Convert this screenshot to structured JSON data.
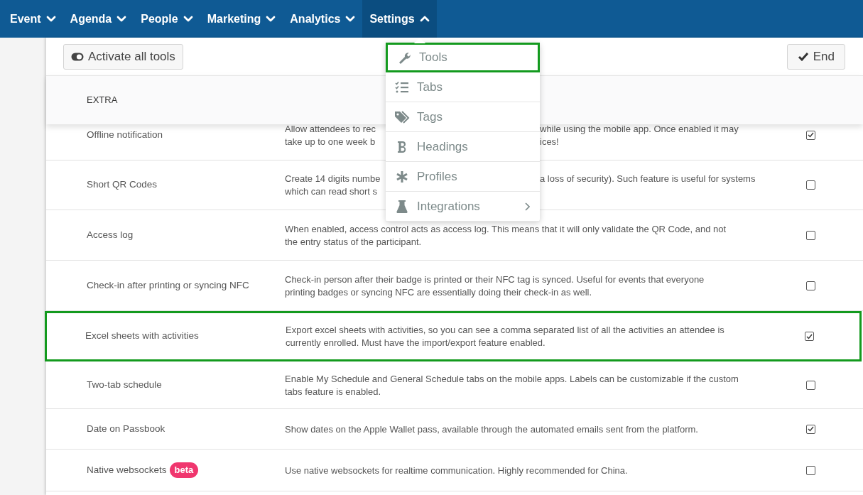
{
  "nav": [
    {
      "label": "Event",
      "expanded": false,
      "selected": false
    },
    {
      "label": "Agenda",
      "expanded": false,
      "selected": false
    },
    {
      "label": "People",
      "expanded": false,
      "selected": false
    },
    {
      "label": "Marketing",
      "expanded": false,
      "selected": false
    },
    {
      "label": "Analytics",
      "expanded": false,
      "selected": false
    },
    {
      "label": "Settings",
      "expanded": true,
      "selected": true
    }
  ],
  "toolbar": {
    "activate_button": "Activate all tools",
    "end_button": "End"
  },
  "section_header": "EXTRA",
  "settings_menu": [
    {
      "kind": "wrench",
      "label": "Tools",
      "selected": true,
      "submenu": false
    },
    {
      "kind": "checklist",
      "label": "Tabs",
      "selected": false,
      "submenu": false
    },
    {
      "kind": "tags",
      "label": "Tags",
      "selected": false,
      "submenu": false
    },
    {
      "kind": "bold",
      "label": "Headings",
      "selected": false,
      "submenu": false
    },
    {
      "kind": "asterisk",
      "label": "Profiles",
      "selected": false,
      "submenu": false
    },
    {
      "kind": "flask",
      "label": "Integrations",
      "selected": false,
      "submenu": true
    }
  ],
  "rows": [
    {
      "name": "Offline notification",
      "checked": true,
      "highlighted": false,
      "description_lines": [
        [
          "Allow attendees to rec",
          "while using the mobile app. Once enabled it may"
        ],
        [
          "take up to one week b",
          "ices!"
        ]
      ]
    },
    {
      "name": "Short QR Codes",
      "checked": false,
      "highlighted": false,
      "description_lines": [
        [
          "Create 14 digits numbe",
          "a loss of security). Such feature is useful for systems"
        ],
        [
          "which can read short s"
        ]
      ]
    },
    {
      "name": "Access log",
      "checked": false,
      "highlighted": false,
      "description_lines": [
        [
          "When enabled, access control acts as access log. This means that it will only validate the QR Code, and not"
        ],
        [
          "the entry status of the participant."
        ]
      ]
    },
    {
      "name": "Check-in after printing or syncing NFC",
      "checked": false,
      "highlighted": false,
      "description_lines": [
        [
          "Check-in person after their badge is printed or their NFC tag is synced. Useful for events that everyone"
        ],
        [
          "printing badges or syncing NFC are essentially doing their check-in as well."
        ]
      ]
    },
    {
      "name": "Excel sheets with activities",
      "checked": true,
      "highlighted": true,
      "description_lines": [
        [
          "Export excel sheets with activities, so you can see a comma separated list of all the activities an attendee is"
        ],
        [
          "currently enrolled. Must have the import/export feature enabled."
        ]
      ]
    },
    {
      "name": "Two-tab schedule",
      "checked": false,
      "highlighted": false,
      "description_lines": [
        [
          "Enable My Schedule and General Schedule tabs on the mobile apps. Labels can be customizable if the custom"
        ],
        [
          "tabs feature is enabled."
        ]
      ]
    },
    {
      "name": "Date on Passbook",
      "checked": true,
      "highlighted": false,
      "description_lines": [
        [
          "Show dates on the Apple Wallet pass, available through the automated emails sent from the platform."
        ]
      ]
    },
    {
      "name": "Native websockets",
      "badge": "beta",
      "checked": false,
      "highlighted": false,
      "description_lines": [
        [
          "Use native websockets for realtime communication. Highly recommended for China."
        ]
      ]
    }
  ]
}
